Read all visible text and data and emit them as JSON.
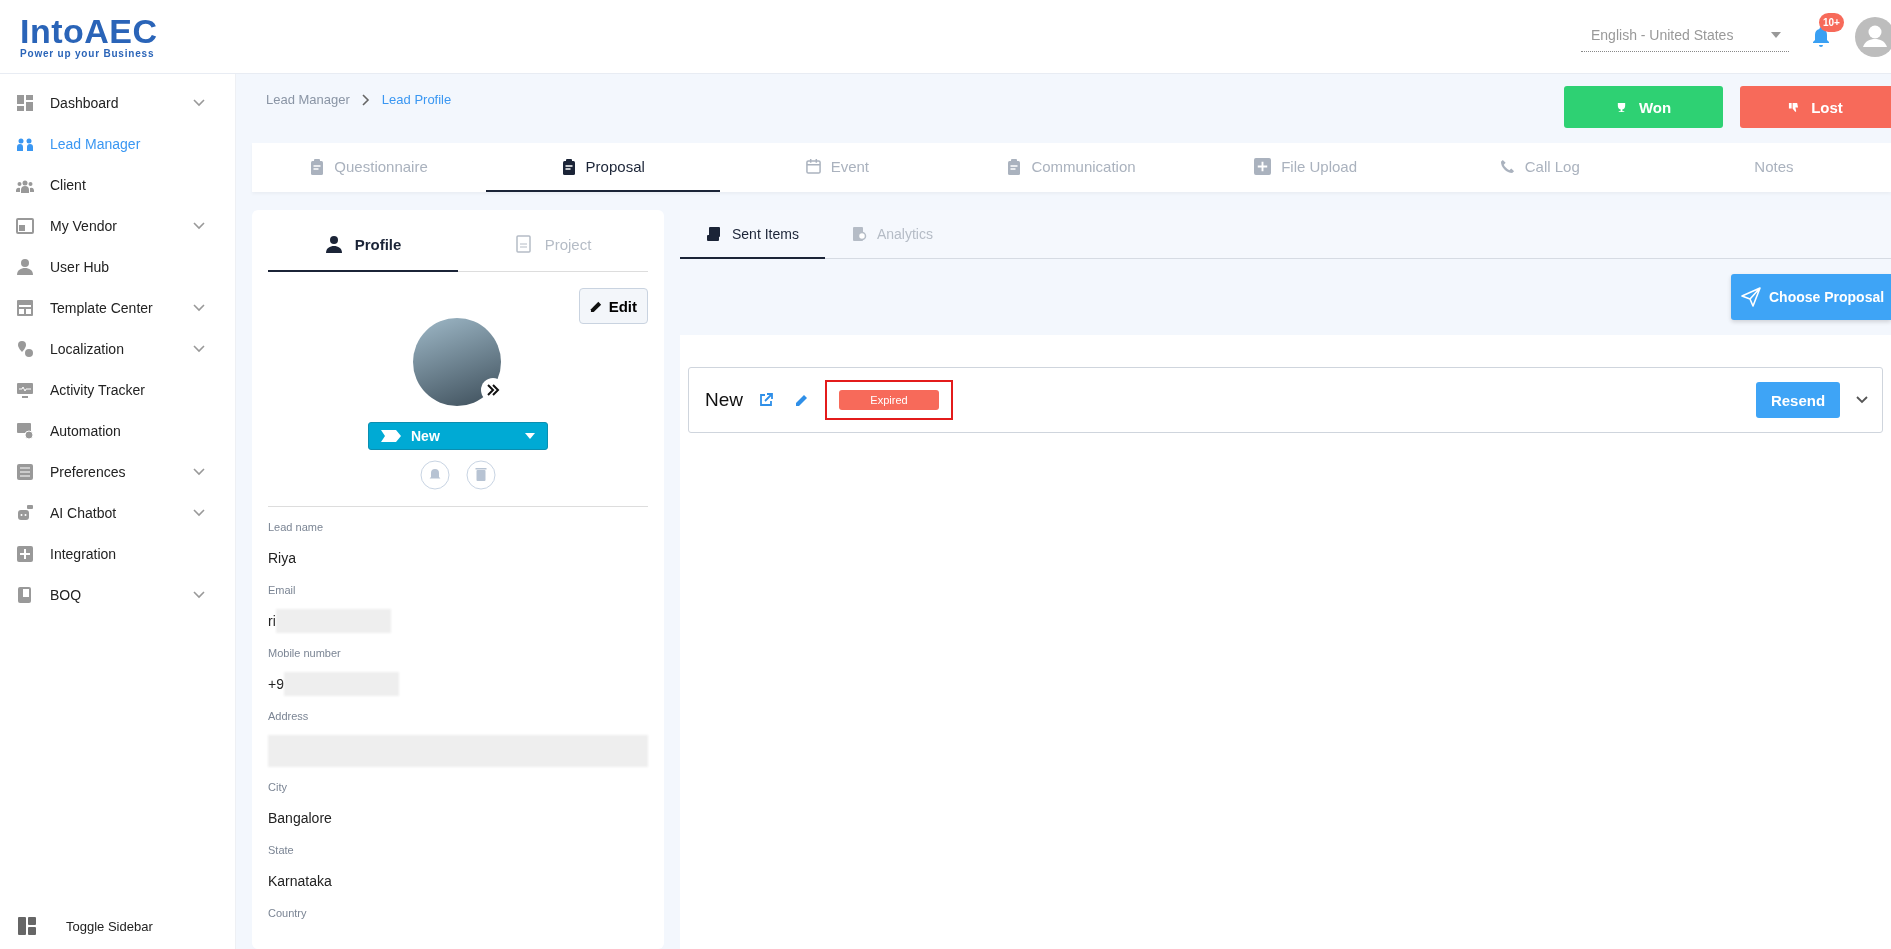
{
  "header": {
    "logo_name": "IntoAEC",
    "logo_tagline": "Power up your Business",
    "language": "English - United States",
    "notification_count": "10+"
  },
  "sidebar": {
    "items": [
      {
        "label": "Dashboard",
        "expandable": true,
        "selected": false
      },
      {
        "label": "Lead Manager",
        "expandable": false,
        "selected": true
      },
      {
        "label": "Client",
        "expandable": false,
        "selected": false
      },
      {
        "label": "My Vendor",
        "expandable": true,
        "selected": false
      },
      {
        "label": "User Hub",
        "expandable": false,
        "selected": false
      },
      {
        "label": "Template Center",
        "expandable": true,
        "selected": false
      },
      {
        "label": "Localization",
        "expandable": true,
        "selected": false
      },
      {
        "label": "Activity Tracker",
        "expandable": false,
        "selected": false
      },
      {
        "label": "Automation",
        "expandable": false,
        "selected": false
      },
      {
        "label": "Preferences",
        "expandable": true,
        "selected": false
      },
      {
        "label": "AI Chatbot",
        "expandable": true,
        "selected": false
      },
      {
        "label": "Integration",
        "expandable": false,
        "selected": false
      },
      {
        "label": "BOQ",
        "expandable": true,
        "selected": false
      }
    ],
    "toggle_label": "Toggle Sidebar"
  },
  "breadcrumb": [
    {
      "label": "Lead Manager",
      "selected": false
    },
    {
      "label": "Lead Profile",
      "selected": true
    }
  ],
  "actions": [
    {
      "label": "Won",
      "kind": "won"
    },
    {
      "label": "Lost",
      "kind": "lost"
    }
  ],
  "tabs": [
    {
      "label": "Questionnaire",
      "selected": false
    },
    {
      "label": "Proposal",
      "selected": true
    },
    {
      "label": "Event",
      "selected": false
    },
    {
      "label": "Communication",
      "selected": false
    },
    {
      "label": "File Upload",
      "selected": false
    },
    {
      "label": "Call Log",
      "selected": false
    },
    {
      "label": "Notes",
      "selected": false
    }
  ],
  "profile": {
    "tabs": [
      {
        "label": "Profile",
        "selected": true
      },
      {
        "label": "Project",
        "selected": false
      }
    ],
    "edit_label": "Edit",
    "status": "New",
    "fields": [
      {
        "label": "Lead name",
        "value": "Riya",
        "redacted": false
      },
      {
        "label": "Email",
        "value": "ri",
        "redacted": true
      },
      {
        "label": "Mobile number",
        "value": "+9",
        "redacted": true
      },
      {
        "label": "Address",
        "redacted": true
      },
      {
        "label": "City",
        "value": "Bangalore",
        "redacted": false
      },
      {
        "label": "State",
        "value": "Karnataka",
        "redacted": false
      },
      {
        "label": "Country",
        "redacted": false
      }
    ]
  },
  "proposals": {
    "tabs": [
      {
        "label": "Sent Items",
        "selected": true
      },
      {
        "label": "Analytics",
        "selected": false
      }
    ],
    "choose_label": "Choose Proposal",
    "items": [
      {
        "name": "New",
        "status": "Expired",
        "highlighted": true,
        "resend_label": "Resend"
      }
    ]
  }
}
